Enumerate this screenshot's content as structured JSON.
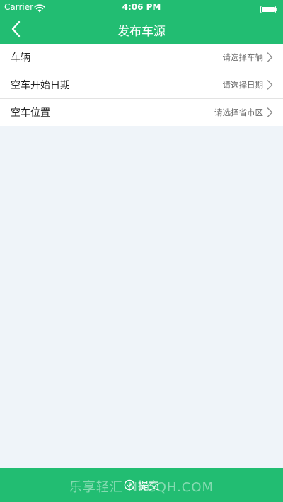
{
  "status_bar": {
    "carrier": "Carrier",
    "time": "4:06 PM"
  },
  "header": {
    "title": "发布车源",
    "back_icon": "chevron-left-icon"
  },
  "form": {
    "rows": [
      {
        "label": "车辆",
        "placeholder": "请选择车辆"
      },
      {
        "label": "空车开始日期",
        "placeholder": "请选择日期"
      },
      {
        "label": "空车位置",
        "placeholder": "请选择省市区"
      }
    ]
  },
  "footer": {
    "submit_label": "提交",
    "watermark": "乐享轻汇 NXCQH.COM",
    "submit_icon": "check-circle-icon"
  },
  "colors": {
    "brand": "#22bd72",
    "background": "#eff4f9"
  }
}
